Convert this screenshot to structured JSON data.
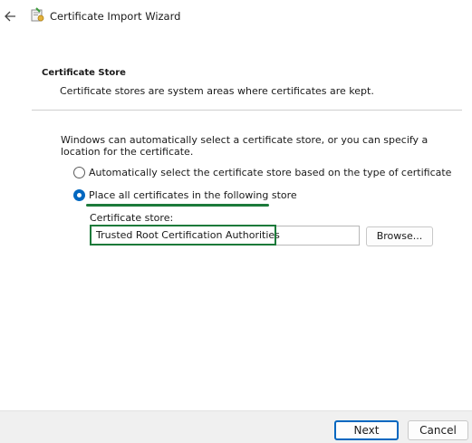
{
  "window": {
    "title": "Certificate Import Wizard",
    "back_icon": "back-arrow-icon",
    "title_icon": "certificate-icon"
  },
  "page": {
    "section_title": "Certificate Store",
    "section_description": "Certificate stores are system areas where certificates are kept.",
    "intro_text": "Windows can automatically select a certificate store, or you can specify a location for the certificate."
  },
  "options": {
    "auto_select": {
      "label": "Automatically select the certificate store based on the type of certificate",
      "checked": false
    },
    "place_all": {
      "label": "Place all certificates in the following store",
      "checked": true
    }
  },
  "store": {
    "label": "Certificate store:",
    "value": "Trusted Root Certification Authorities",
    "browse_label": "Browse..."
  },
  "footer": {
    "next_label": "Next",
    "cancel_label": "Cancel"
  },
  "colors": {
    "accent": "#0067c0",
    "highlight": "#1c7a3a"
  }
}
